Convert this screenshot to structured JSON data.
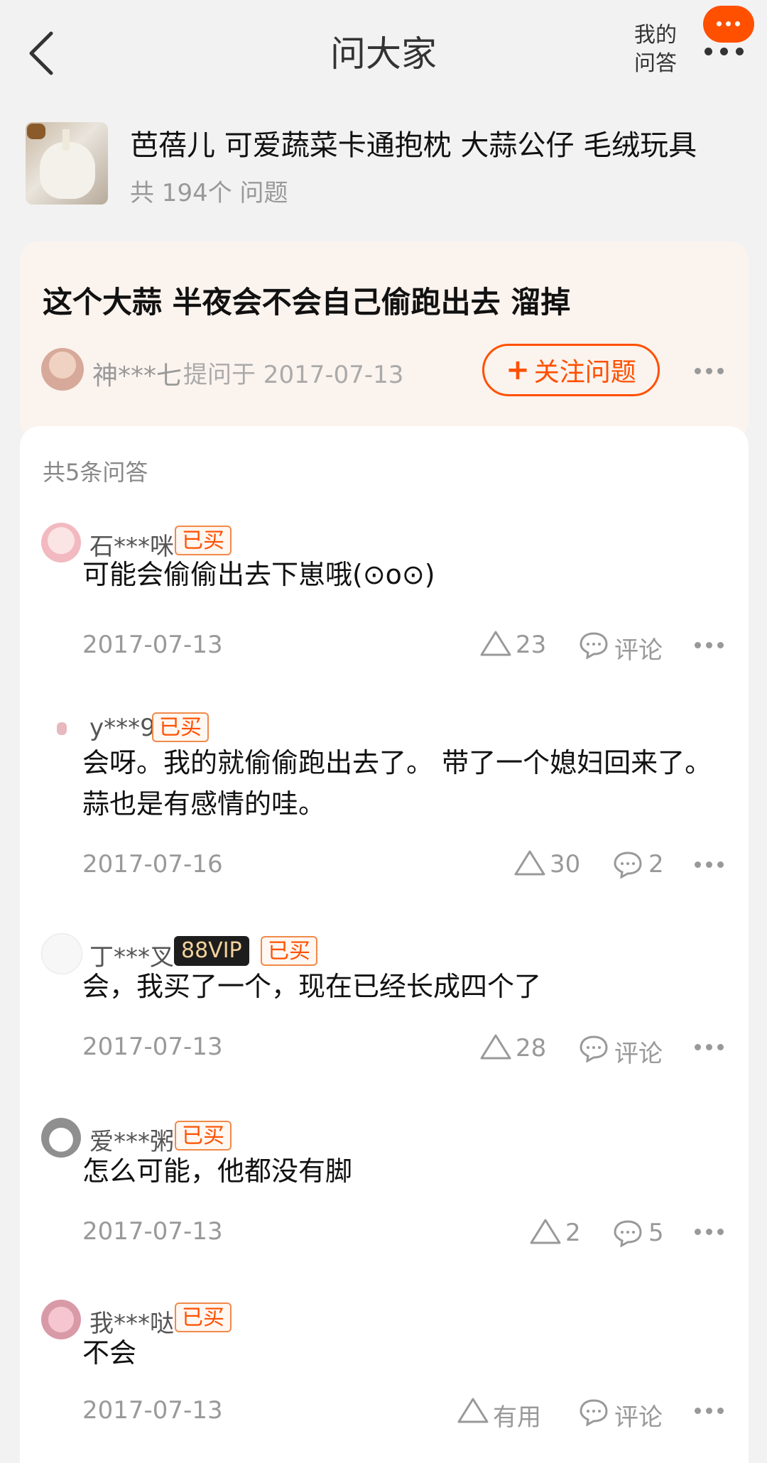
{
  "header": {
    "title": "问大家",
    "my_qa_line1": "我的",
    "my_qa_line2": "问答"
  },
  "product": {
    "name": "芭蓓儿 可爱蔬菜卡通抱枕 大蒜公仔 毛绒玩具",
    "question_count": "共 194个 问题"
  },
  "question": {
    "text": "这个大蒜 半夜会不会自己偷跑出去 溜掉",
    "asker": "神***七",
    "asked_on": "提问于 2017-07-13",
    "follow_label": "关注问题"
  },
  "answers_header": "共5条问答",
  "bought_label": "已买",
  "answers": [
    {
      "user": "石***咪",
      "text": "可能会偷偷出去下崽哦(⊙o⊙)",
      "date": "2017-07-13",
      "likes": "23",
      "comments": "评论"
    },
    {
      "user": "y***9",
      "text": "会呀。我的就偷偷跑出去了。 带了一个媳妇回来了。蒜也是有感情的哇。",
      "date": "2017-07-16",
      "likes": "30",
      "comments": "2"
    },
    {
      "user": "丁***叉",
      "vip": "88VIP",
      "text": "会，我买了一个，现在已经长成四个了",
      "date": "2017-07-13",
      "likes": "28",
      "comments": "评论"
    },
    {
      "user": "爱***粥",
      "text": "怎么可能，他都没有脚",
      "date": "2017-07-13",
      "likes": "2",
      "comments": "5"
    },
    {
      "user": "我***哒",
      "text": "不会",
      "date": "2017-07-13",
      "likes": "有用",
      "comments": "评论"
    }
  ],
  "colors": {
    "accent": "#ff5000",
    "muted": "#999999"
  }
}
